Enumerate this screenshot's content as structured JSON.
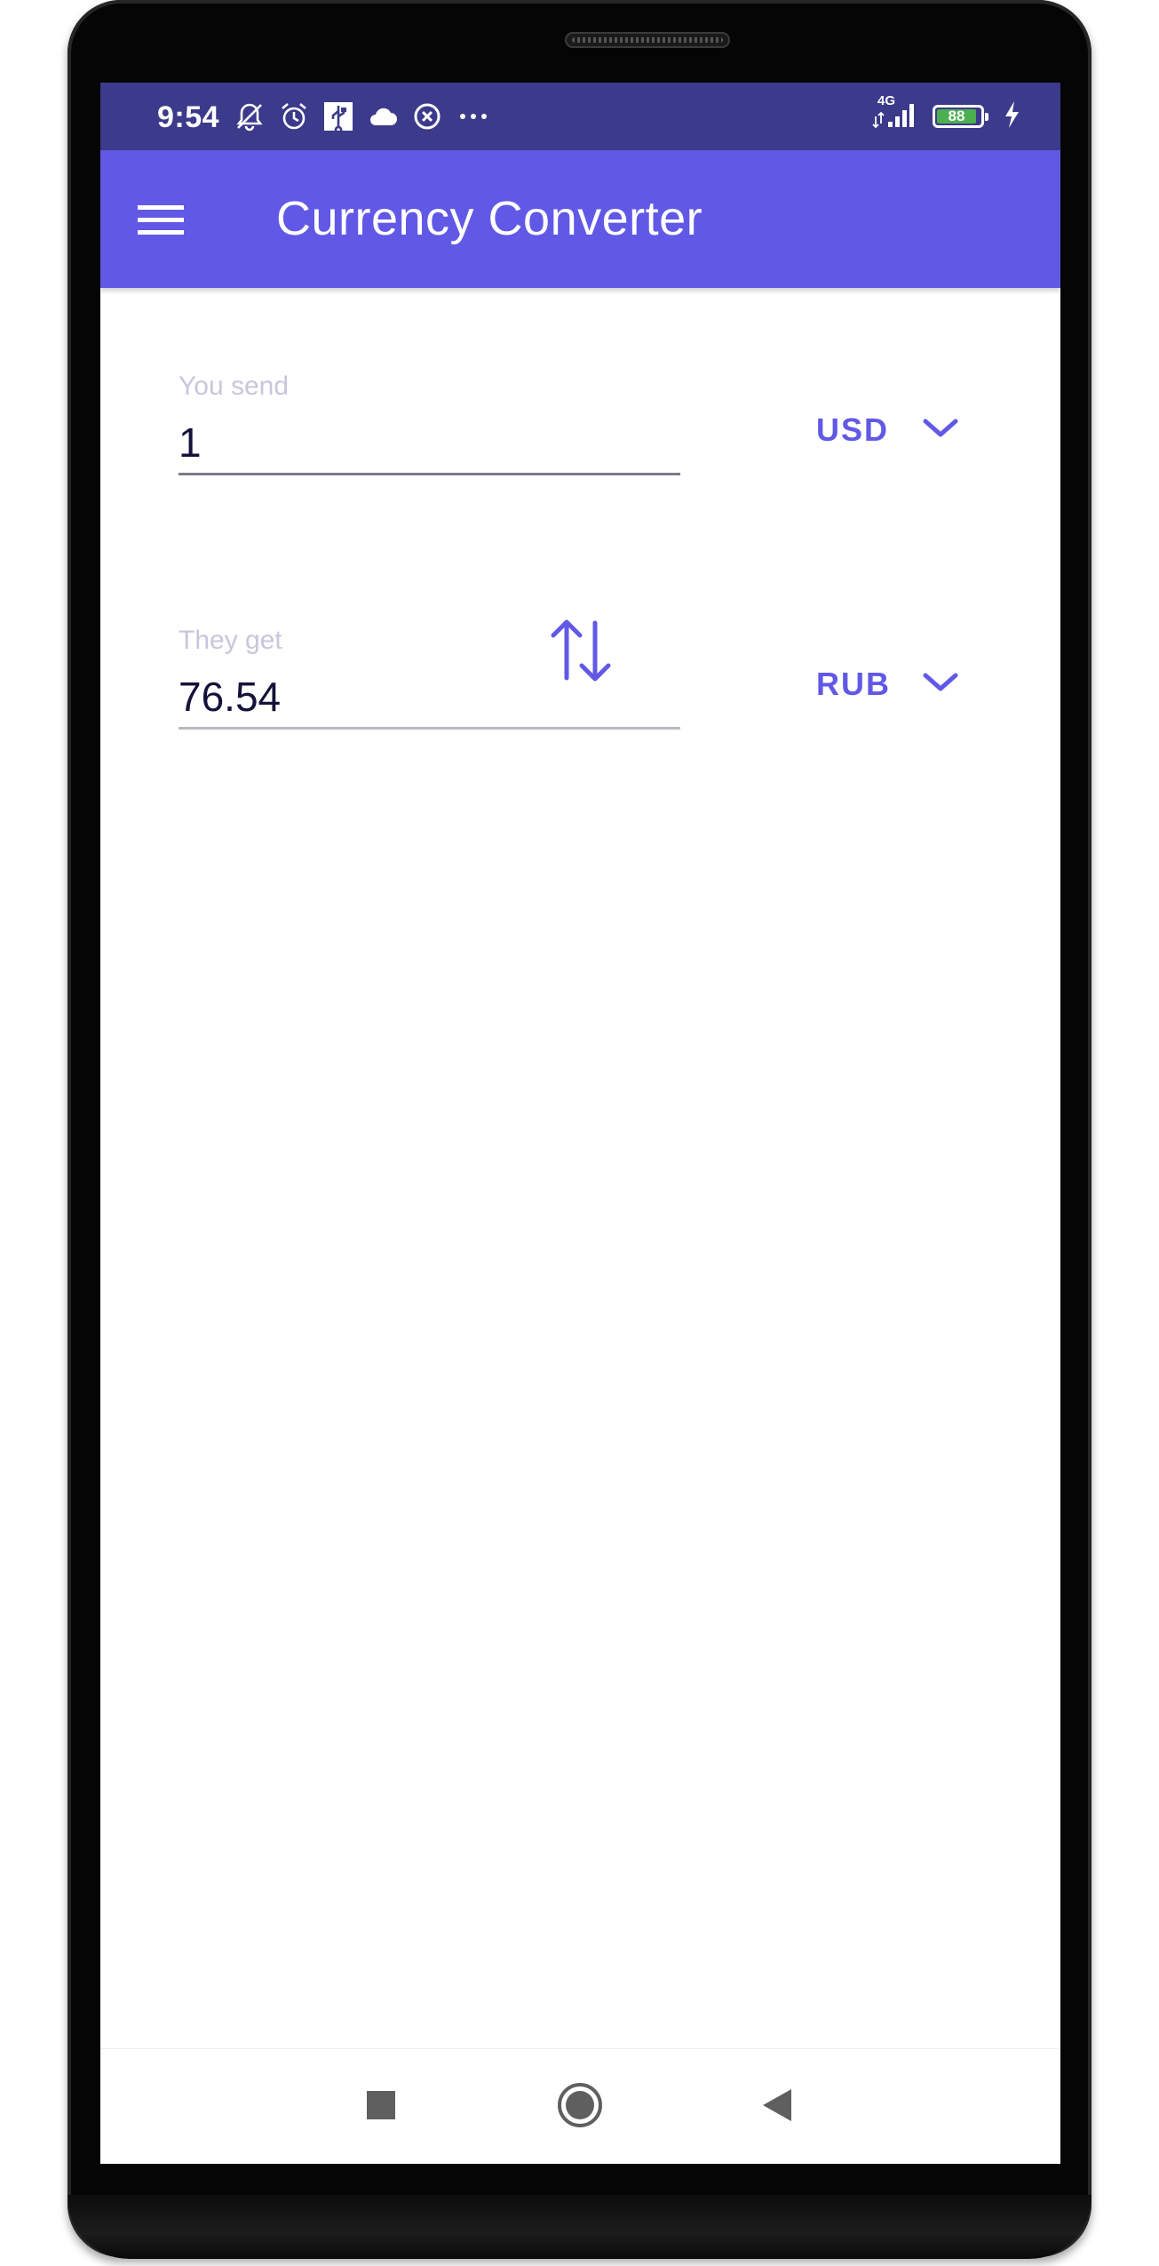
{
  "status_bar": {
    "time": "9:54",
    "network": "4G",
    "battery_level": "88",
    "icons": [
      "notifications-off-icon",
      "alarm-icon",
      "usb-icon",
      "cloud-icon",
      "data-saver-icon",
      "more-dots-icon",
      "signal-icon",
      "battery-icon",
      "charging-icon"
    ]
  },
  "app_bar": {
    "title": "Currency Converter",
    "menu_icon": "hamburger-menu-icon"
  },
  "converter": {
    "send": {
      "label": "You send",
      "value": "1",
      "currency": "USD"
    },
    "get": {
      "label": "They get",
      "value": "76.54",
      "currency": "RUB"
    },
    "swap_icon": "swap-vertical-icon"
  },
  "nav_bar": {
    "buttons": [
      "recents-square-icon",
      "home-circle-icon",
      "back-triangle-icon"
    ]
  },
  "colors": {
    "primary": "#6159e6",
    "status_bar": "#3c3a8a",
    "label": "#c7c6dc",
    "text": "#14123a"
  }
}
